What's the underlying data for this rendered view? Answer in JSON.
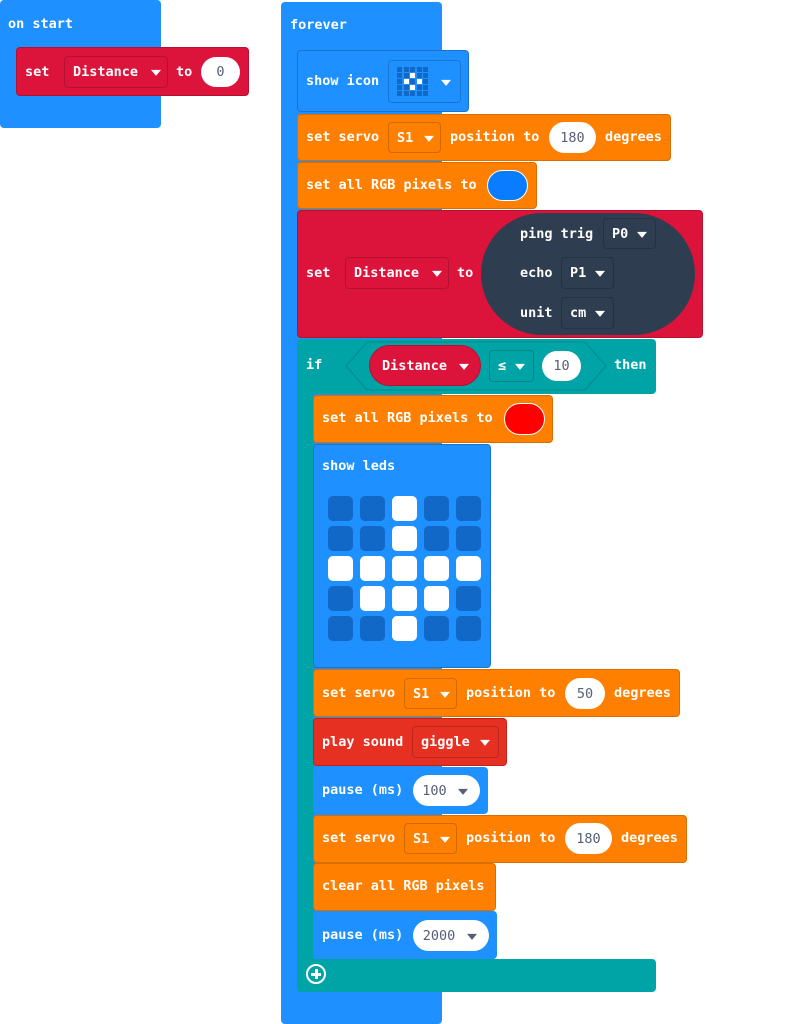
{
  "on_start": {
    "hat_label": "on start",
    "set_block": {
      "keyword": "set",
      "variable": "Distance",
      "to_label": "to",
      "value": "0"
    }
  },
  "forever": {
    "hat_label": "forever",
    "show_icon": {
      "label": "show icon",
      "icon": "small-diamond",
      "pattern": [
        [
          0,
          0,
          0,
          0,
          0
        ],
        [
          0,
          0,
          1,
          0,
          0
        ],
        [
          0,
          1,
          0,
          1,
          0
        ],
        [
          0,
          0,
          1,
          0,
          0
        ],
        [
          0,
          0,
          0,
          0,
          0
        ]
      ]
    },
    "servo1": {
      "prefix": "set servo",
      "servo": "S1",
      "mid": "position to",
      "value": "180",
      "suffix": "degrees"
    },
    "rgb1": {
      "label": "set all RGB pixels to",
      "color": "#0a7cff"
    },
    "set_distance": {
      "keyword": "set",
      "variable": "Distance",
      "to_label": "to",
      "ping": {
        "trig_label": "ping trig",
        "trig_pin": "P0",
        "echo_label": "echo",
        "echo_pin": "P1",
        "unit_label": "unit",
        "unit": "cm"
      }
    },
    "if_block": {
      "if_label": "if",
      "variable": "Distance",
      "operator": "≤",
      "value": "10",
      "then_label": "then",
      "rgb2": {
        "label": "set all RGB pixels to",
        "color": "#ff0000"
      },
      "show_leds": {
        "label": "show leds",
        "pattern": [
          [
            0,
            0,
            1,
            0,
            0
          ],
          [
            0,
            0,
            1,
            0,
            0
          ],
          [
            1,
            1,
            1,
            1,
            1
          ],
          [
            0,
            1,
            1,
            1,
            0
          ],
          [
            0,
            0,
            1,
            0,
            0
          ]
        ]
      },
      "servo2": {
        "prefix": "set servo",
        "servo": "S1",
        "mid": "position to",
        "value": "50",
        "suffix": "degrees"
      },
      "sound": {
        "label": "play sound",
        "sound": "giggle"
      },
      "pause1": {
        "label": "pause (ms)",
        "value": "100"
      },
      "servo3": {
        "prefix": "set servo",
        "servo": "S1",
        "mid": "position to",
        "value": "180",
        "suffix": "degrees"
      },
      "clear": {
        "label": "clear all RGB pixels"
      },
      "pause2": {
        "label": "pause (ms)",
        "value": "2000"
      },
      "add_icon": "plus-circle-icon"
    }
  }
}
